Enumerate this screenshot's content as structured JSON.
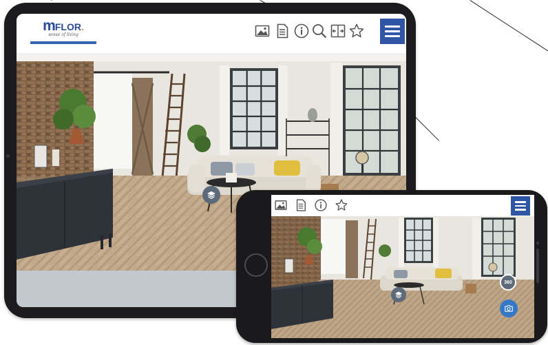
{
  "brand": {
    "logo_main": "m",
    "logo_word": "FLOR",
    "logo_dot": ".",
    "tagline": "sense of living"
  },
  "tablet_toolbar": {
    "icons": [
      "image-icon",
      "document-icon",
      "info-icon",
      "search-icon",
      "compare-icon",
      "star-icon"
    ],
    "menu": "hamburger-menu-icon"
  },
  "phone_toolbar": {
    "icons": [
      "image-icon",
      "document-icon",
      "info-icon",
      "star-icon"
    ],
    "menu": "hamburger-menu-icon"
  },
  "phone_buttons": {
    "view_360": "360",
    "camera": "camera-icon",
    "layers": "layers-icon"
  },
  "colors": {
    "brand_blue": "#2f55a4",
    "device_body": "#1c1c1e",
    "floor_oak": "#bfa68a",
    "sofa": "#e3ddd2",
    "cushion_yellow": "#e0bf3e"
  }
}
